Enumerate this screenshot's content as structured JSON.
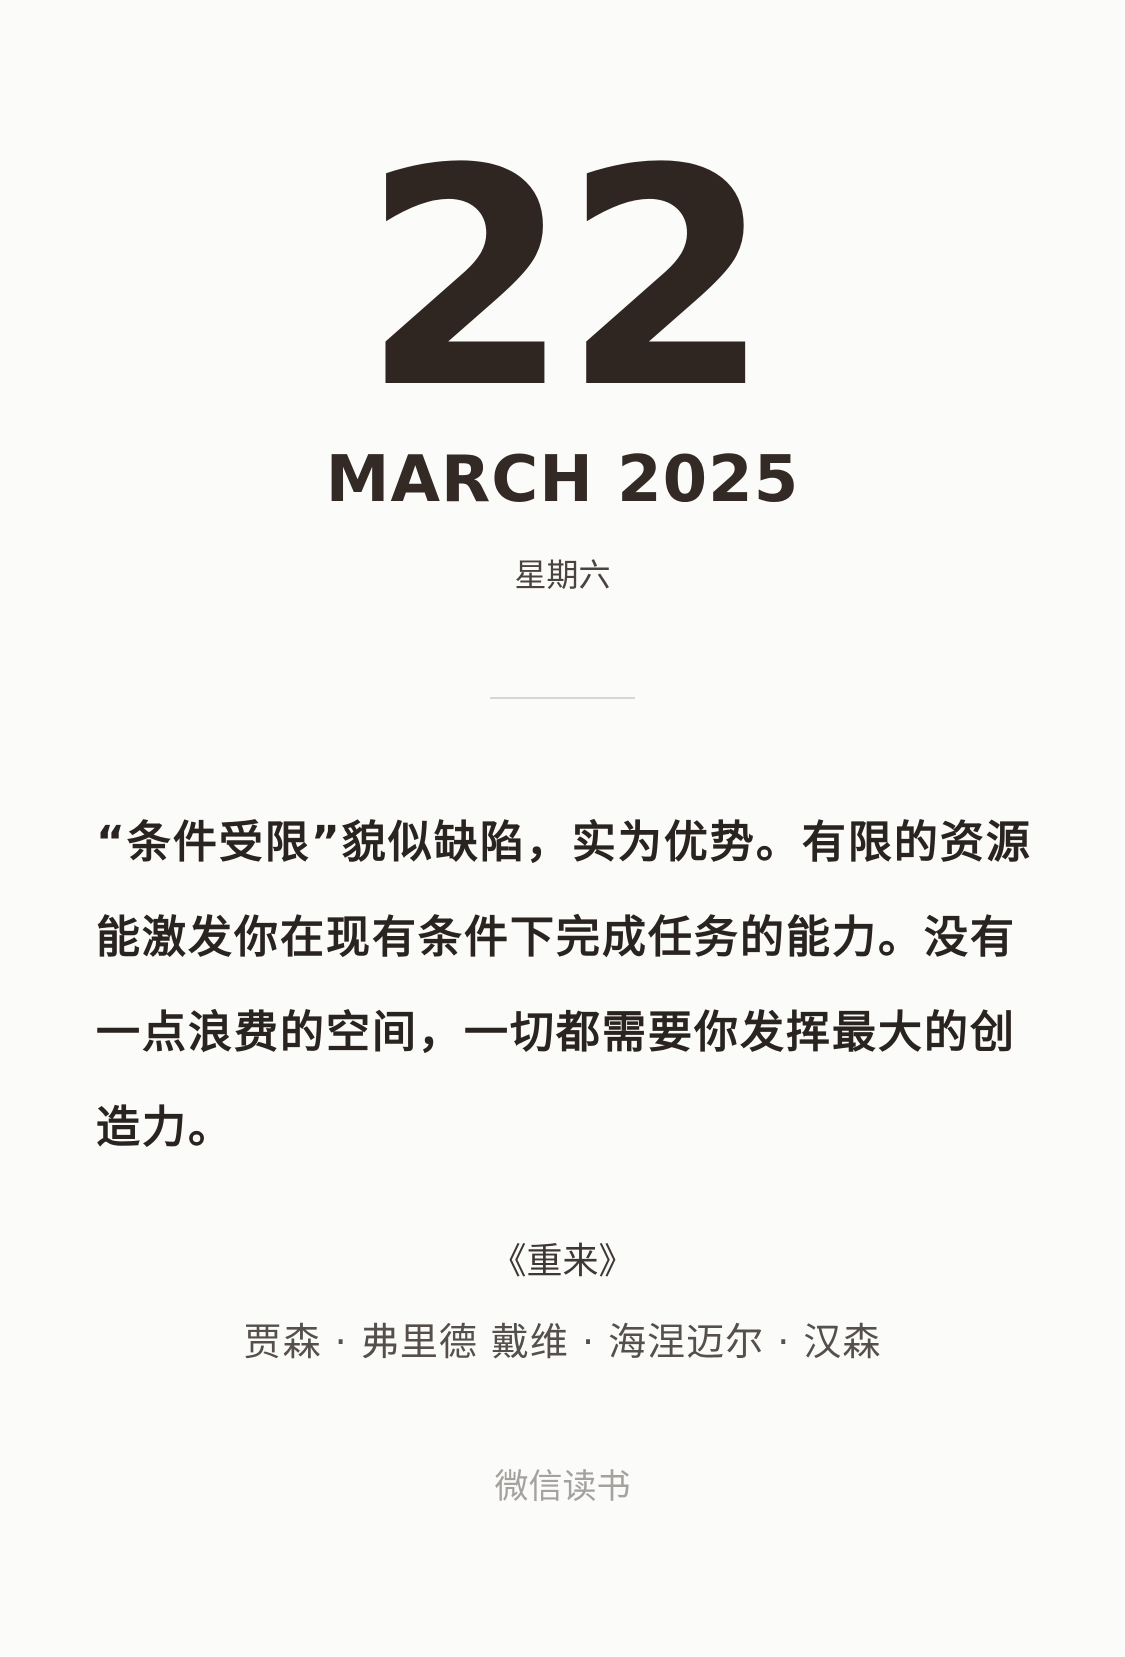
{
  "date": {
    "day": "22",
    "month_year": "MARCH 2025",
    "weekday": "星期六"
  },
  "quote": {
    "text": "“条件受限”貌似缺陷，实为优势。有限的资源能激发你在现有条件下完成任务的能力。没有一点浪费的空间，一切都需要你发挥最大的创造力。"
  },
  "book": {
    "title": "《重来》",
    "authors": "贾森 · 弗里德 戴维 · 海涅迈尔 · 汉森"
  },
  "footer": {
    "source": "微信读书"
  },
  "colors": {
    "background": "#fbfbfa",
    "text_dark": "#2f2621",
    "text_muted": "#a4a19f",
    "divider": "#d8d6d3"
  }
}
